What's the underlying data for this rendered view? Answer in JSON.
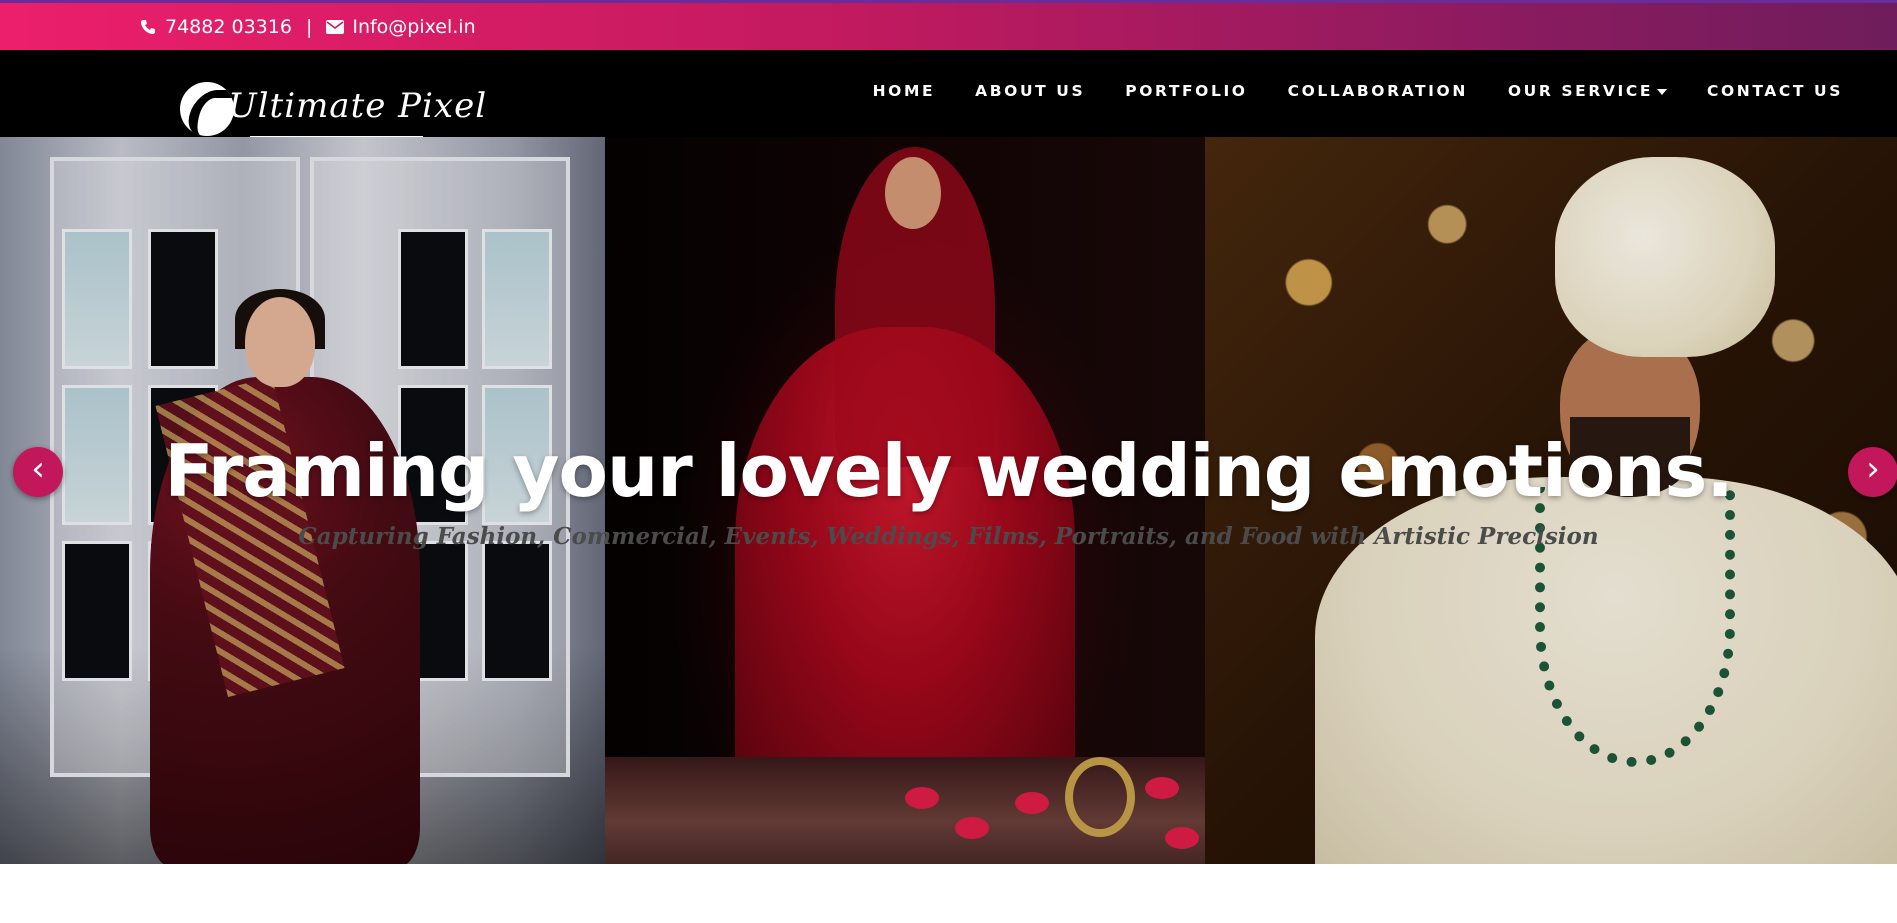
{
  "topbar": {
    "phone_icon": "phone-icon",
    "phone": "74882 03316",
    "separator": "|",
    "email_icon": "envelope-icon",
    "email": "Info@pixel.in",
    "gradient_start": "#ec1f6c",
    "gradient_end": "#6f1d5c"
  },
  "header": {
    "logo_text": "Ultimate Pixel",
    "nav": [
      {
        "label": "HOME"
      },
      {
        "label": "ABOUT US"
      },
      {
        "label": "PORTFOLIO"
      },
      {
        "label": "COLLABORATION"
      },
      {
        "label": "OUR SERVICE"
      },
      {
        "label": "CONTACT US"
      }
    ]
  },
  "hero": {
    "headline": "Framing your lovely wedding emotions.",
    "subheadline": "Capturing Fashion, Commercial, Events, Weddings, Films, Portraits, and Food with Artistic Precision",
    "prev_label": "‹",
    "next_label": "›",
    "accent": "#c2185b"
  }
}
